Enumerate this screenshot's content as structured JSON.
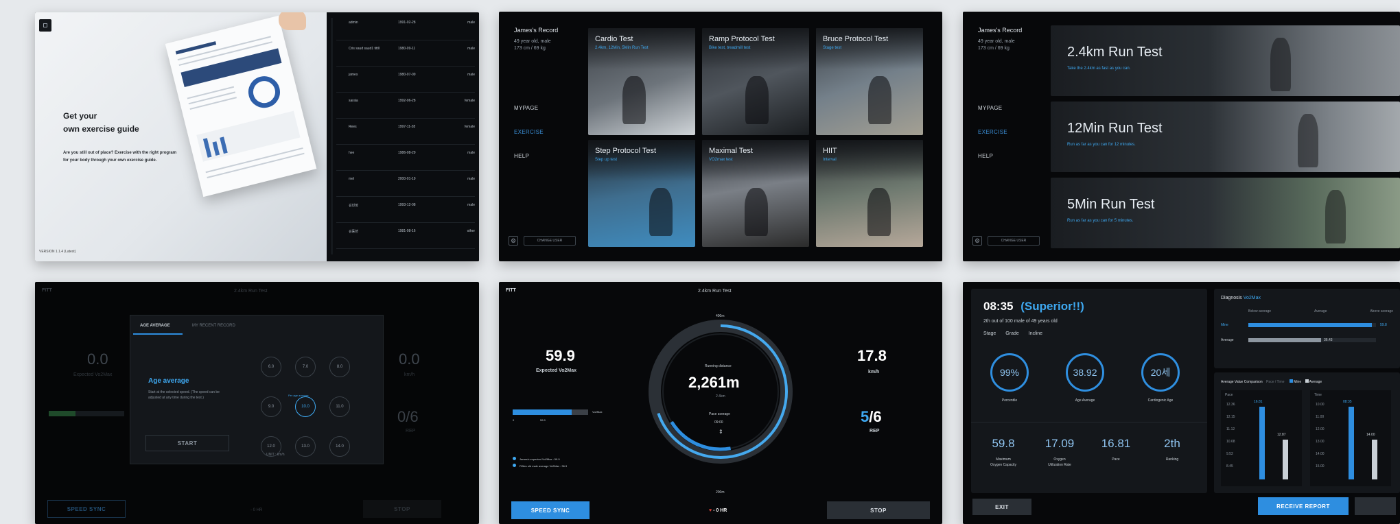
{
  "p1": {
    "title_line1": "Get your",
    "title_line2": "own exercise guide",
    "desc_line1": "Are you still out of place? Exercise with the right program",
    "desc_line2": "for your body through your own exercise guide.",
    "version": "VERSION 1.1.4 (Latest)",
    "users": [
      {
        "name": "admin",
        "date": "1991-02-28",
        "gender": "male"
      },
      {
        "name": "Cris saud saud1 tittll",
        "date": "1980-09-11",
        "gender": "male"
      },
      {
        "name": "james",
        "date": "1980-07-09",
        "gender": "male"
      },
      {
        "name": "sarala",
        "date": "1992-06-28",
        "gender": "female"
      },
      {
        "name": "Rees",
        "date": "1997-11-28",
        "gender": "female"
      },
      {
        "name": "hee",
        "date": "1986-08-29",
        "gender": "male"
      },
      {
        "name": "mel",
        "date": "2000-01-19",
        "gender": "male"
      },
      {
        "name": "김민정",
        "date": "1993-12-08",
        "gender": "male"
      },
      {
        "name": "김동현",
        "date": "1981-08-16",
        "gender": "other"
      }
    ]
  },
  "profile": {
    "name": "James's Record",
    "line1": "49 year old, male",
    "line2": "173 cm / 69 kg",
    "menu": [
      "MYPAGE",
      "EXERCISE",
      "HELP"
    ],
    "button": "CHANGE USER"
  },
  "p2": {
    "tiles": [
      {
        "title": "Cardio Test",
        "sub": "2.4km, 12Min, 5Min Run Test"
      },
      {
        "title": "Ramp Protocol Test",
        "sub": "Bike test, treadmill test"
      },
      {
        "title": "Bruce Protocol Test",
        "sub": "Stage test"
      },
      {
        "title": "Step Protocol Test",
        "sub": "Step up test"
      },
      {
        "title": "Maximal Test",
        "sub": "VO2max test"
      },
      {
        "title": "HIIT",
        "sub": "Interval"
      }
    ]
  },
  "p3": {
    "tests": [
      {
        "title": "2.4km Run Test",
        "sub": "Take the 2.4km as fast as you can."
      },
      {
        "title": "12Min Run Test",
        "sub": "Run as far as you can for 12 minutes."
      },
      {
        "title": "5Min Run Test",
        "sub": "Run as far as you can for 5 minutes."
      }
    ]
  },
  "p4": {
    "brand": "FITT",
    "header": "2.4km Run Test",
    "left_value": "0.0",
    "left_label": "Expected Vo2Max",
    "right_value": "0.0",
    "right_label": "km/h",
    "rep": "0/6",
    "rep_label": "REP",
    "tab1": "AGE AVERAGE",
    "tab2": "MY RECENT RECORD",
    "modal_title": "Age average",
    "modal_desc1": "Start at the selected speed. (The speed can be",
    "modal_desc2": "adjusted at any time during the test.)",
    "start": "START",
    "speed_grid": [
      "6.0",
      "7.0",
      "8.0",
      "9.0",
      "10.0",
      "11.0",
      "12.0",
      "13.0",
      "14.0"
    ],
    "speed_hint": "Per age average",
    "unit": "UNIT : km/h",
    "speed_sync": "SPEED SYNC",
    "stop": "STOP",
    "hr": "- 0 HR"
  },
  "p5": {
    "brand": "FITT",
    "header": "2.4km Run Test",
    "vo2": "59.9",
    "vo2_label": "Expected Vo2Max",
    "bar_label": "Vo2Max",
    "bar_min": "0",
    "bar_val": "59.9",
    "legend1": "James's expected Vo2Max : 59.9",
    "legend2": "Fifties old male average Vo2Max : 36.3",
    "top_dist": "400m",
    "bottom_dist": "200m",
    "ring_label": "Running distance",
    "distance": "2,261m",
    "distance_sub": "2.4km",
    "pace_label": "Pace average",
    "pace_val": "09:00",
    "speed": "17.8",
    "speed_unit": "km/h",
    "rep_done": "5",
    "rep_total": "/6",
    "rep_label": "REP",
    "speed_sync": "SPEED SYNC",
    "stop": "STOP",
    "hr": "- 0 HR"
  },
  "p6": {
    "time": "08:35",
    "grade": "(Superior!!)",
    "rank_text": "2th out of 100 male of 49 years old",
    "stage_labels": [
      "Stage",
      "Grade",
      "Incline"
    ],
    "circles": [
      {
        "value": "99%",
        "label": "Percentile"
      },
      {
        "value": "38.92",
        "label": "Age Average"
      },
      {
        "value": "20세",
        "label": "Cardiogenic Age"
      }
    ],
    "stats": [
      {
        "value": "59.8",
        "label1": "Maximum",
        "label2": "Oxygen Capacity"
      },
      {
        "value": "17.09",
        "label1": "Oxygen",
        "label2": "Utilization Rate"
      },
      {
        "value": "16.81",
        "label1": "Pace",
        "label2": ""
      },
      {
        "value": "2th",
        "label1": "Ranking",
        "label2": ""
      }
    ],
    "exit": "EXIT",
    "receive": "RECEIVE REPORT",
    "diag_title": "Diagnosis",
    "diag_sub": "Vo2Max",
    "diag_cols": [
      "Below average",
      "Average",
      "Above average"
    ],
    "diag_rows": [
      {
        "label": "Mine",
        "value": "59.8",
        "fill": 0.97
      },
      {
        "label": "Average",
        "value": "36.43",
        "fill": 0.57
      }
    ],
    "compare_title": "Average Value Comparison",
    "compare_sub": "Pace / Time",
    "legend_mine": "Mine",
    "legend_avg": "Average",
    "pace_title": "Pace",
    "time_title": "Time",
    "pace_rows": [
      "12.36",
      "12.15",
      "11.12",
      "10.68",
      "9.52",
      "8.45"
    ],
    "time_rows": [
      "10.00",
      "11.00",
      "12.00",
      "13.00",
      "14.00",
      "15.00"
    ],
    "pace_bars": [
      {
        "label": "16.81",
        "fill": 0.92
      },
      {
        "label": "12.87",
        "fill": 0.5
      }
    ],
    "time_bars": [
      {
        "label": "08:35",
        "fill": 0.92
      },
      {
        "label": "14.00",
        "fill": 0.5
      }
    ]
  }
}
